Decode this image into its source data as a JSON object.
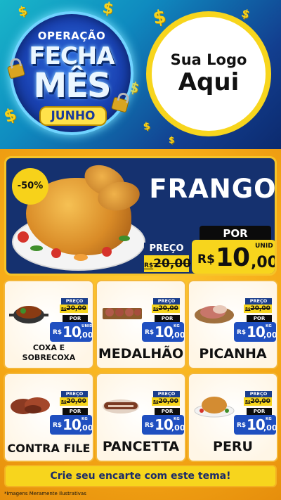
{
  "header": {
    "badge": {
      "line1": "OPERAÇÃO",
      "line2": "FECHA",
      "line3": "MÊS",
      "month": "JUNHO"
    },
    "logo": {
      "line1": "Sua Logo",
      "line2": "Aqui"
    },
    "dollar_symbol": "$"
  },
  "featured": {
    "discount": "-50%",
    "name": "FRANGO",
    "old_label": "PREÇO",
    "old_currency": "R$",
    "old_price": "20,00",
    "new_label": "POR",
    "new_currency": "R$",
    "new_int": "10",
    "new_dec": ",00",
    "unit": "UNID"
  },
  "products": [
    {
      "name": "COXA E SOBRECOXA",
      "old_label": "PREÇO",
      "old_currency": "R$",
      "old_price": "20,00",
      "new_label": "POR",
      "new_currency": "R$",
      "new_int": "10",
      "new_dec": ",00",
      "unit": "UNID"
    },
    {
      "name": "MEDALHÃO",
      "old_label": "PREÇO",
      "old_currency": "R$",
      "old_price": "20,00",
      "new_label": "POR",
      "new_currency": "R$",
      "new_int": "10",
      "new_dec": ",00",
      "unit": "KG"
    },
    {
      "name": "PICANHA",
      "old_label": "PREÇO",
      "old_currency": "R$",
      "old_price": "20,00",
      "new_label": "POR",
      "new_currency": "R$",
      "new_int": "10",
      "new_dec": ",00",
      "unit": "KG"
    },
    {
      "name": "CONTRA FILE",
      "old_label": "PREÇO",
      "old_currency": "R$",
      "old_price": "20,00",
      "new_label": "POR",
      "new_currency": "R$",
      "new_int": "10",
      "new_dec": ",00",
      "unit": "KG"
    },
    {
      "name": "PANCETTA",
      "old_label": "PREÇO",
      "old_currency": "R$",
      "old_price": "20,00",
      "new_label": "POR",
      "new_currency": "R$",
      "new_int": "10",
      "new_dec": ",00",
      "unit": "KG"
    },
    {
      "name": "PERU",
      "old_label": "PREÇO",
      "old_currency": "R$",
      "old_price": "20,00",
      "new_label": "POR",
      "new_currency": "R$",
      "new_int": "10",
      "new_dec": ",00",
      "unit": "KG"
    }
  ],
  "footer": {
    "cta": "Crie seu encarte com este tema!",
    "disclaimer": "*Imagens Meramente Ilustrativas"
  },
  "colors": {
    "navy": "#15316f",
    "yellow": "#f7d51d",
    "orange": "#f5a916",
    "price_blue": "#1f4fc0"
  }
}
